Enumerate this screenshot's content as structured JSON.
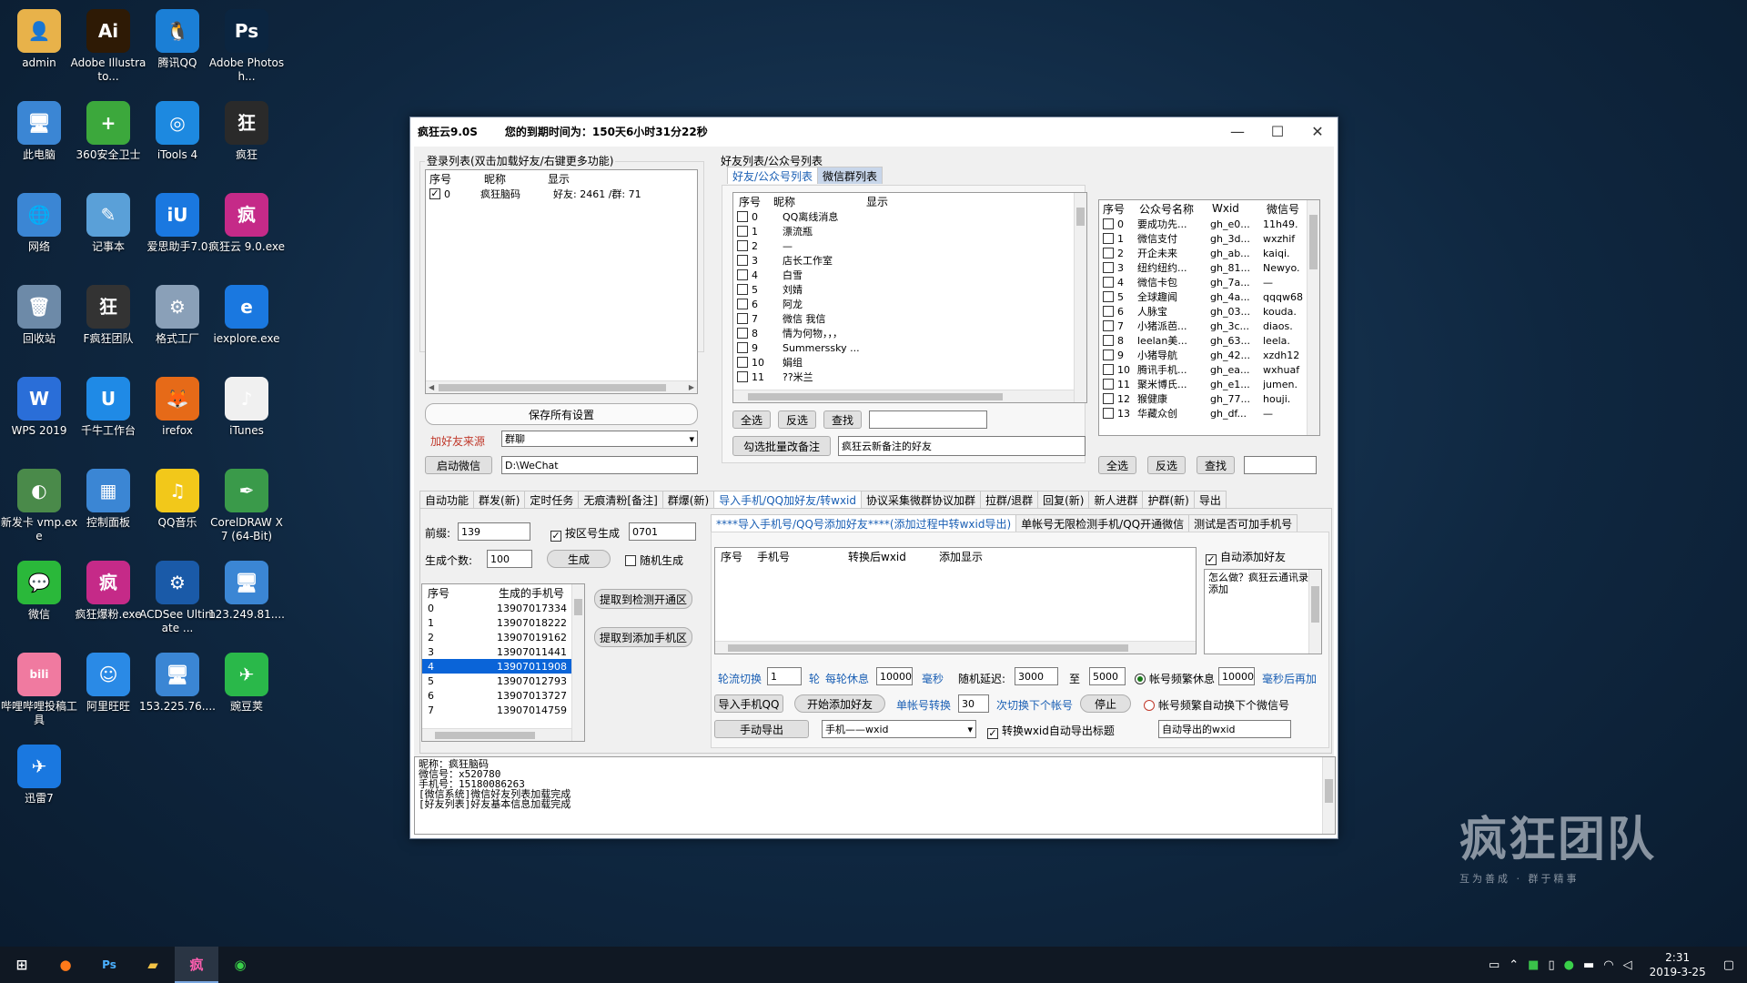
{
  "desktop": {
    "icons": [
      {
        "label": "admin",
        "bg": "#e8b24a",
        "glyph": "👤"
      },
      {
        "label": "Adobe Illustrato...",
        "bg": "#2e1a05",
        "glyph": "Ai"
      },
      {
        "label": "腾讯QQ",
        "bg": "#1b7fd6",
        "glyph": "🐧"
      },
      {
        "label": "Adobe Photosh...",
        "bg": "#0b2540",
        "glyph": "Ps"
      },
      {
        "label": "此电脑",
        "bg": "#3b86d4",
        "glyph": "🖥"
      },
      {
        "label": "360安全卫士",
        "bg": "#3ca83c",
        "glyph": "+"
      },
      {
        "label": "iTools 4",
        "bg": "#1d89e0",
        "glyph": "◎"
      },
      {
        "label": "疯狂",
        "bg": "#2a2a2a",
        "glyph": "狂"
      },
      {
        "label": "网络",
        "bg": "#3b86d4",
        "glyph": "🌐"
      },
      {
        "label": "记事本",
        "bg": "#5aa0d8",
        "glyph": "✎"
      },
      {
        "label": "爱思助手7.0",
        "bg": "#1a78e0",
        "glyph": "iU"
      },
      {
        "label": "疯狂云 9.0.exe",
        "bg": "#c52a88",
        "glyph": "疯"
      },
      {
        "label": "回收站",
        "bg": "#6d8aa8",
        "glyph": "🗑"
      },
      {
        "label": "F疯狂团队",
        "bg": "#333333",
        "glyph": "狂"
      },
      {
        "label": "格式工厂",
        "bg": "#8aa0b8",
        "glyph": "⚙"
      },
      {
        "label": "iexplore.exe",
        "bg": "#1a78e0",
        "glyph": "e"
      },
      {
        "label": "WPS 2019",
        "bg": "#2a6ed8",
        "glyph": "W"
      },
      {
        "label": "千牛工作台",
        "bg": "#1f8ae6",
        "glyph": "U"
      },
      {
        "label": "irefox",
        "bg": "#e66a18",
        "glyph": "🦊"
      },
      {
        "label": "iTunes",
        "bg": "#f0f0f0",
        "glyph": "♪"
      },
      {
        "label": "新发卡 vmp.exe",
        "bg": "#4a8a4a",
        "glyph": "◐"
      },
      {
        "label": "控制面板",
        "bg": "#3b86d4",
        "glyph": "▦"
      },
      {
        "label": "QQ音乐",
        "bg": "#f2c81a",
        "glyph": "♫"
      },
      {
        "label": "CorelDRAW X7 (64-Bit)",
        "bg": "#3a9a4a",
        "glyph": "✒"
      },
      {
        "label": "微信",
        "bg": "#2ab83a",
        "glyph": "💬"
      },
      {
        "label": "疯狂爆粉.exe",
        "bg": "#c52a88",
        "glyph": "疯"
      },
      {
        "label": "ACDSee Ultimate ...",
        "bg": "#1a5aa8",
        "glyph": "⚙"
      },
      {
        "label": "123.249.81....",
        "bg": "#3b86d4",
        "glyph": "🖥"
      },
      {
        "label": "哔哩哔哩投稿工具",
        "bg": "#f07aa0",
        "glyph": "bili"
      },
      {
        "label": "阿里旺旺",
        "bg": "#2a8ae6",
        "glyph": "☺"
      },
      {
        "label": "153.225.76....",
        "bg": "#3b86d4",
        "glyph": "🖥"
      },
      {
        "label": "豌豆荚",
        "bg": "#2ab84a",
        "glyph": "✈"
      },
      {
        "label": "迅雷7",
        "bg": "#1a78e0",
        "glyph": "✈"
      }
    ],
    "watermark": "疯狂团队",
    "watermark_sub": "互为善成 · 群于精事"
  },
  "window": {
    "title": "疯狂云9.0S",
    "expiry": "您的到期时间为：150天6小时31分22秒",
    "controls": [
      "—",
      "☐",
      "✕"
    ]
  },
  "login": {
    "group_label": "登录列表(双击加载好友/右键更多功能)",
    "headers": [
      "序号",
      "昵称",
      "显示"
    ],
    "rows": [
      {
        "idx": "0",
        "name": "疯狂脑码",
        "show": "好友: 2461 /群: 71",
        "checked": "✓"
      }
    ],
    "save_btn": "保存所有设置",
    "source_label": "加好友来源",
    "source_value": "群聊",
    "start_btn": "启动微信",
    "path": "D:\\WeChat"
  },
  "friends": {
    "group_label": "好友列表/公众号列表",
    "tabs": [
      "好友/公众号列表",
      "微信群列表"
    ],
    "headers": [
      "序号",
      "昵称",
      "显示"
    ],
    "rows": [
      {
        "idx": "0",
        "name": "QQ离线消息"
      },
      {
        "idx": "1",
        "name": "漂流瓶"
      },
      {
        "idx": "2",
        "name": "—"
      },
      {
        "idx": "3",
        "name": "店长工作室"
      },
      {
        "idx": "4",
        "name": "白雪"
      },
      {
        "idx": "5",
        "name": "刘婧"
      },
      {
        "idx": "6",
        "name": "阿龙"
      },
      {
        "idx": "7",
        "name": "微信  我信"
      },
      {
        "idx": "8",
        "name": "情为何物，，，"
      },
      {
        "idx": "9",
        "name": "Summerssky ..."
      },
      {
        "idx": "10",
        "name": "娟组"
      },
      {
        "idx": "11",
        "name": "??米兰"
      }
    ],
    "select_all": "全选",
    "invert": "反选",
    "find": "查找",
    "batch_btn": "勾选批量改备注",
    "remark_value": "疯狂云新备注的好友"
  },
  "official": {
    "headers": [
      "序号",
      "公众号名称",
      "Wxid",
      "微信号"
    ],
    "rows": [
      {
        "idx": "0",
        "name": "要成功先...",
        "wxid": "gh_e0...",
        "wx": "11h49."
      },
      {
        "idx": "1",
        "name": "微信支付",
        "wxid": "gh_3d...",
        "wx": "wxzhif"
      },
      {
        "idx": "2",
        "name": "开企未来",
        "wxid": "gh_ab...",
        "wx": "kaiqi."
      },
      {
        "idx": "3",
        "name": "纽约纽约...",
        "wxid": "gh_81...",
        "wx": "Newyo."
      },
      {
        "idx": "4",
        "name": "微信卡包",
        "wxid": "gh_7a...",
        "wx": "—"
      },
      {
        "idx": "5",
        "name": "全球趣闻",
        "wxid": "gh_4a...",
        "wx": "qqqw68"
      },
      {
        "idx": "6",
        "name": "人脉宝",
        "wxid": "gh_03...",
        "wx": "kouda."
      },
      {
        "idx": "7",
        "name": "小猪派芭...",
        "wxid": "gh_3c...",
        "wx": "diaos."
      },
      {
        "idx": "8",
        "name": "leelan美...",
        "wxid": "gh_63...",
        "wx": "leela."
      },
      {
        "idx": "9",
        "name": "小猪导航",
        "wxid": "gh_42...",
        "wx": "xzdh12"
      },
      {
        "idx": "10",
        "name": "腾讯手机...",
        "wxid": "gh_ea...",
        "wx": "wxhuaf"
      },
      {
        "idx": "11",
        "name": "聚米博氏...",
        "wxid": "gh_e1...",
        "wx": "jumen."
      },
      {
        "idx": "12",
        "name": "猴健康",
        "wxid": "gh_77...",
        "wx": "houji."
      },
      {
        "idx": "13",
        "name": "华藏众创",
        "wxid": "gh_df...",
        "wx": "—"
      }
    ],
    "select_all": "全选",
    "invert": "反选",
    "find": "查找"
  },
  "main_tabs": [
    "自动功能",
    "群发(新)",
    "定时任务",
    "无痕清粉[备注]",
    "群爆(新)",
    "导入手机/QQ加好友/转wxid",
    "协议采集微群协议加群",
    "拉群/退群",
    "回复(新)",
    "新人进群",
    "护群(新)",
    "导出"
  ],
  "sub_tabs": [
    "****导入手机号/QQ号添加好友****(添加过程中转wxid导出)",
    "单帐号无限检测手机/QQ开通微信",
    "测试是否可加手机号"
  ],
  "gen": {
    "prefix_label": "前缀:",
    "prefix": "139",
    "by_area": "按区号生成",
    "area": "0701",
    "count_label": "生成个数:",
    "count": "100",
    "gen_btn": "生成",
    "random": "随机生成",
    "headers": [
      "序号",
      "生成的手机号"
    ],
    "rows": [
      {
        "idx": "0",
        "phone": "13907017334"
      },
      {
        "idx": "1",
        "phone": "13907018222"
      },
      {
        "idx": "2",
        "phone": "13907019162"
      },
      {
        "idx": "3",
        "phone": "13907011441"
      },
      {
        "idx": "4",
        "phone": "13907011908"
      },
      {
        "idx": "5",
        "phone": "13907012793"
      },
      {
        "idx": "6",
        "phone": "13907013727"
      },
      {
        "idx": "7",
        "phone": "13907014759"
      }
    ],
    "btn_detect": "提取到检测开通区",
    "btn_add": "提取到添加手机区"
  },
  "add": {
    "headers": [
      "序号",
      "手机号",
      "转换后wxid",
      "添加显示"
    ],
    "auto_add": "自动添加好友",
    "note": "怎么做？疯狂云通讯录添加",
    "rotate_label": "轮流切换",
    "rotate": "1",
    "rotate_unit": "轮",
    "rest_label": "每轮休息",
    "rest": "10000",
    "ms": "毫秒",
    "delay_label": "随机延迟:",
    "delay_min": "3000",
    "to": "至",
    "delay_max": "5000",
    "freq_rest": "帐号频繁休息",
    "freq_ms": "10000",
    "freq_after": "毫秒后再加",
    "import_btn": "导入手机QQ",
    "start_btn": "开始添加好友",
    "single_label": "单帐号转换",
    "single": "30",
    "next_label": "次切换下个帐号",
    "stop_btn": "停止",
    "freq_switch": "帐号频繁自动换下个微信号",
    "manual_export": "手动导出",
    "export_mode": "手机——wxid",
    "auto_title": "转换wxid自动导出标题",
    "auto_export_value": "自动导出的wxid"
  },
  "log": [
    "昵称：疯狂脑码",
    "微信号：x520780",
    "手机号：15180086263",
    "[微信系统]微信好友列表加载完成",
    "[好友列表]好友基本信息加载完成"
  ],
  "taskbar": {
    "time": "2:31",
    "date": "2019-3-25"
  }
}
